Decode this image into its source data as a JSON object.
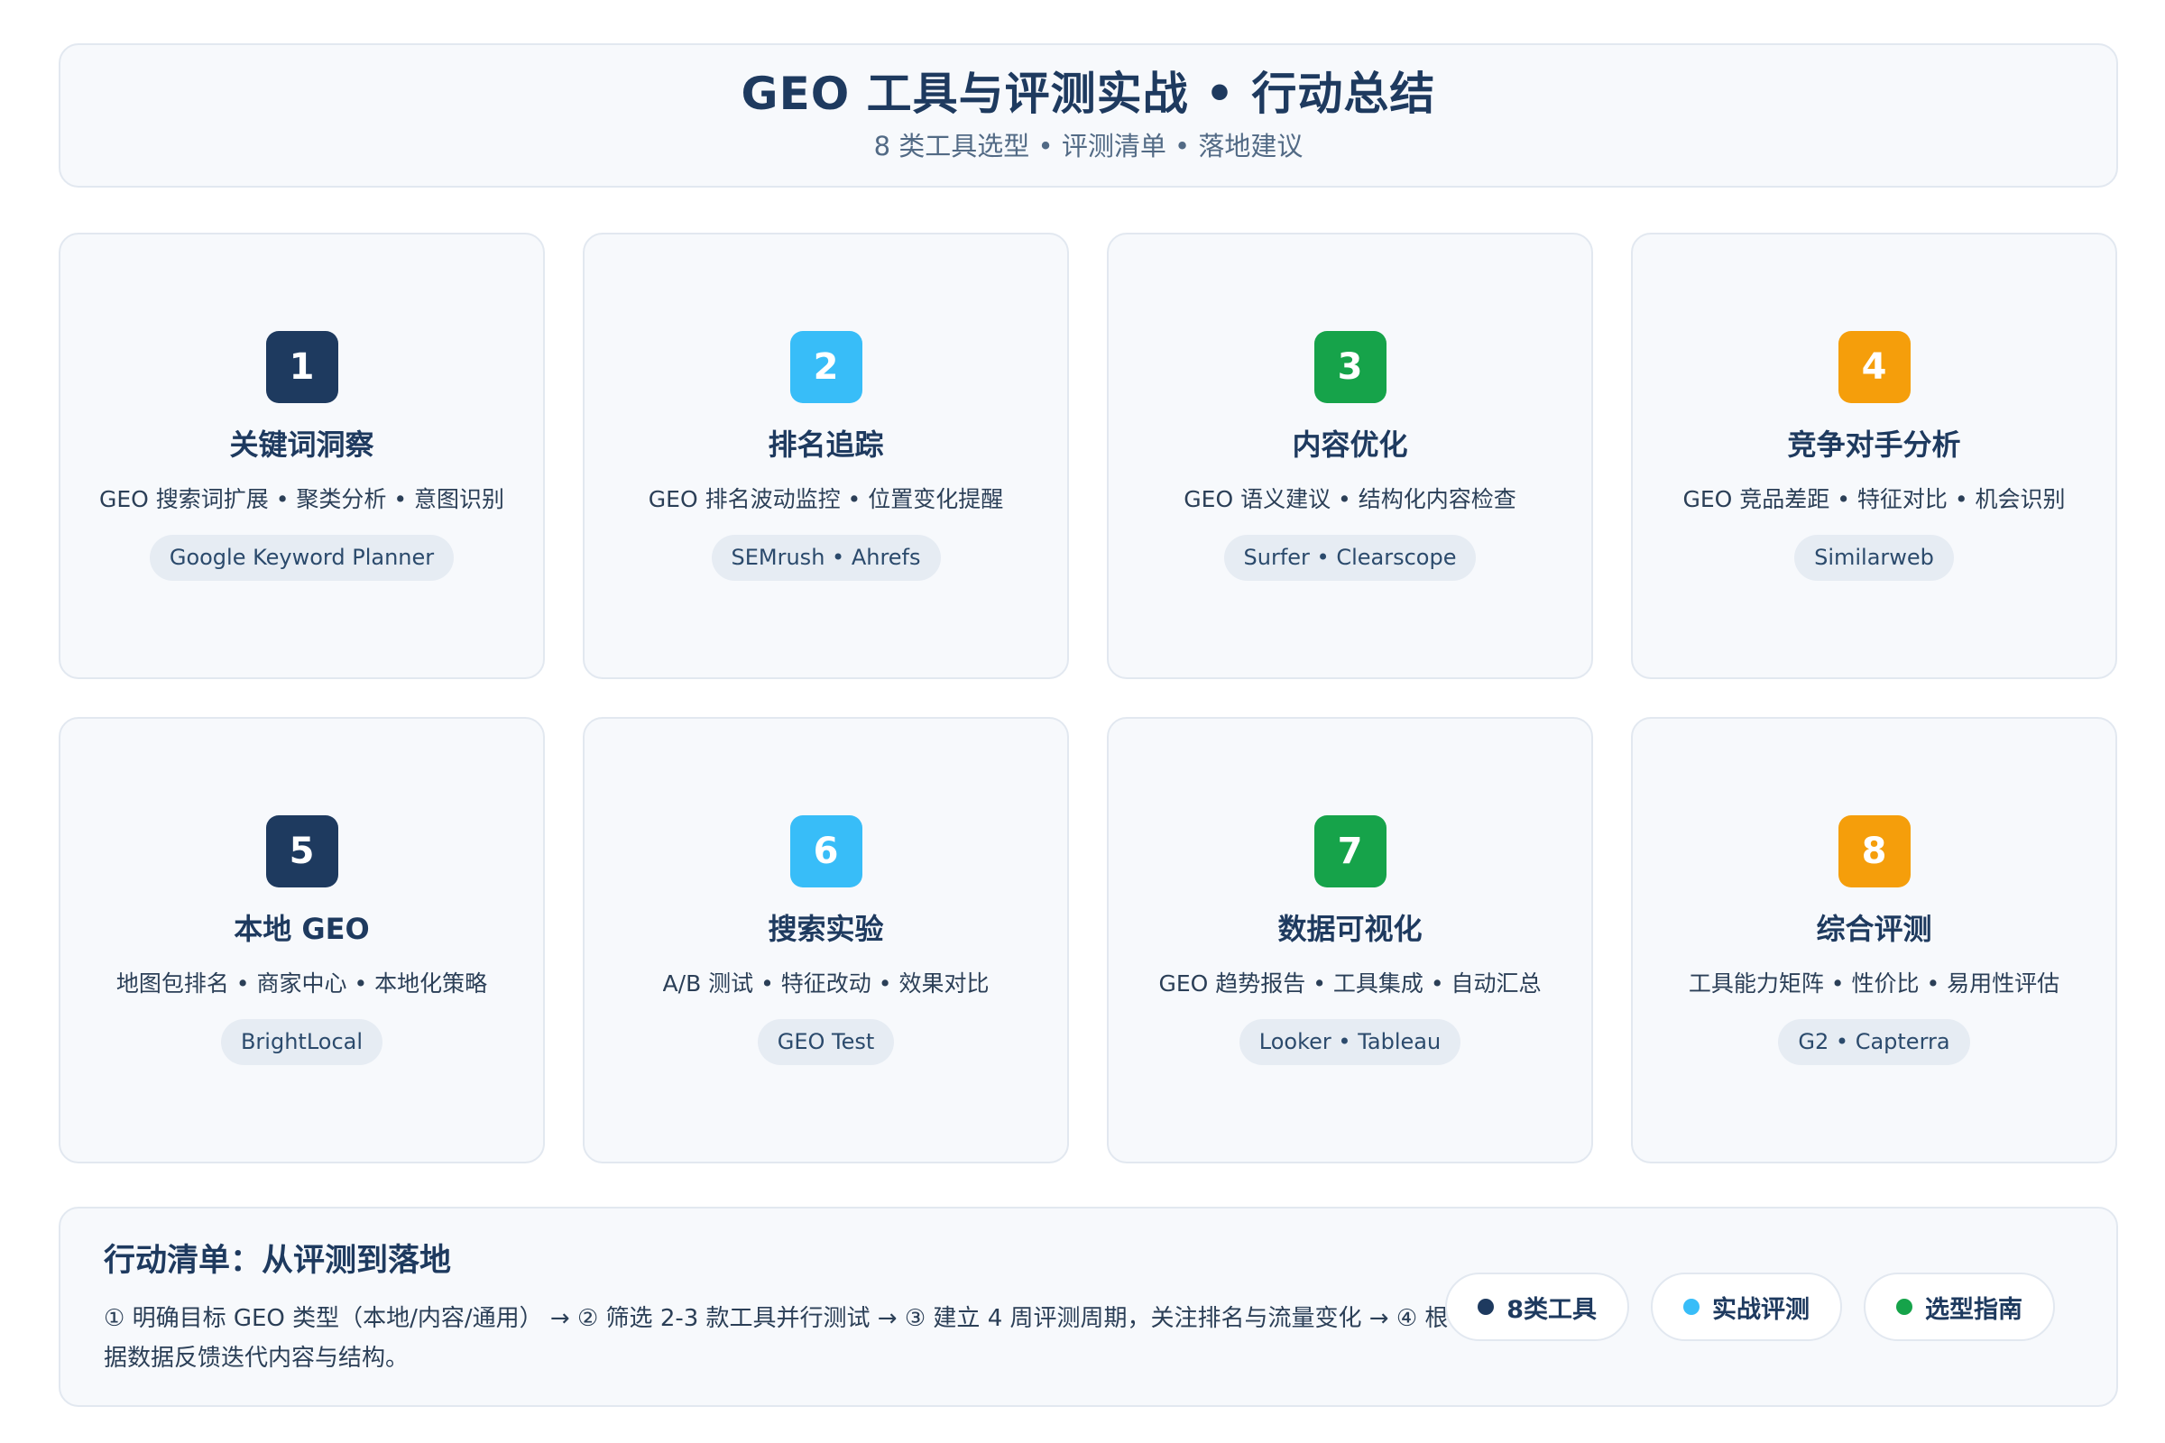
{
  "header": {
    "title": "GEO 工具与评测实战 • 行动总结",
    "subtitle": "8 类工具选型 • 评测清单 • 落地建议"
  },
  "cards": [
    {
      "number": "1",
      "color": "#1e3a5f",
      "title": "关键词洞察",
      "desc": "GEO 搜索词扩展 • 聚类分析 • 意图识别",
      "tag": "Google Keyword Planner"
    },
    {
      "number": "2",
      "color": "#38bdf8",
      "title": "排名追踪",
      "desc": "GEO 排名波动监控 • 位置变化提醒",
      "tag": "SEMrush • Ahrefs"
    },
    {
      "number": "3",
      "color": "#16a34a",
      "title": "内容优化",
      "desc": "GEO 语义建议 • 结构化内容检查",
      "tag": "Surfer • Clearscope"
    },
    {
      "number": "4",
      "color": "#f59e0b",
      "title": "竞争对手分析",
      "desc": "GEO 竞品差距 • 特征对比 • 机会识别",
      "tag": "Similarweb"
    },
    {
      "number": "5",
      "color": "#1e3a5f",
      "title": "本地 GEO",
      "desc": "地图包排名 • 商家中心 • 本地化策略",
      "tag": "BrightLocal"
    },
    {
      "number": "6",
      "color": "#38bdf8",
      "title": "搜索实验",
      "desc": "A/B 测试 • 特征改动 • 效果对比",
      "tag": "GEO Test"
    },
    {
      "number": "7",
      "color": "#16a34a",
      "title": "数据可视化",
      "desc": "GEO 趋势报告 • 工具集成 • 自动汇总",
      "tag": "Looker • Tableau"
    },
    {
      "number": "8",
      "color": "#f59e0b",
      "title": "综合评测",
      "desc": "工具能力矩阵 • 性价比 • 易用性评估",
      "tag": "G2 • Capterra"
    }
  ],
  "action": {
    "title": "行动清单：从评测到落地",
    "text": "① 明确目标 GEO 类型（本地/内容/通用） → ② 筛选 2-3 款工具并行测试 → ③ 建立 4 周评测周期，关注排名与流量变化 → ④ 根据数据反馈迭代内容与结构。",
    "pills": [
      {
        "label": "8类工具",
        "color": "#1e3a5f"
      },
      {
        "label": "实战评测",
        "color": "#38bdf8"
      },
      {
        "label": "选型指南",
        "color": "#16a34a"
      }
    ]
  }
}
